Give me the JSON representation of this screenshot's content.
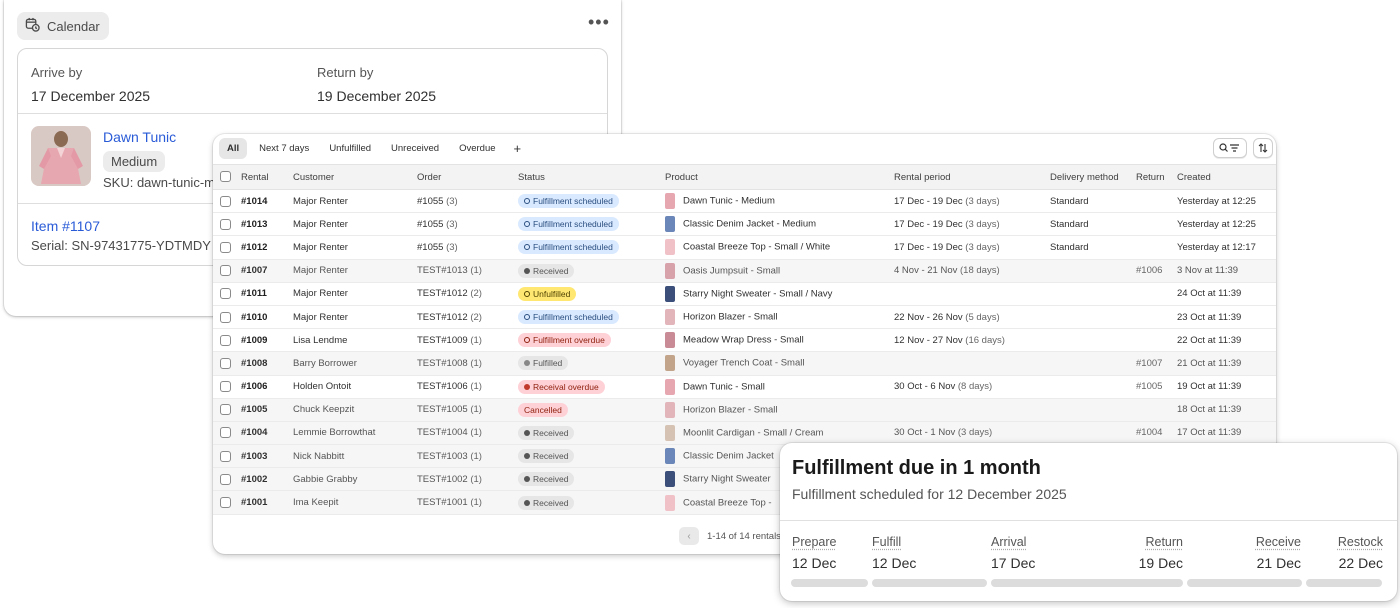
{
  "detail": {
    "calendar_label": "Calendar",
    "more_label": "•••",
    "arrive_label": "Arrive by",
    "arrive_value": "17 December 2025",
    "return_label": "Return by",
    "return_value": "19 December 2025",
    "product_name": "Dawn Tunic",
    "variant": "Medium",
    "sku": "SKU: dawn-tunic-m",
    "item_link": "Item #1107",
    "serial": "Serial: SN-97431775-YDTMDY"
  },
  "table": {
    "tabs": [
      "All",
      "Next 7 days",
      "Unfulfilled",
      "Unreceived",
      "Overdue"
    ],
    "add_tab": "+",
    "columns": [
      "Rental",
      "Customer",
      "Order",
      "Status",
      "Product",
      "Rental period",
      "Delivery method",
      "Return",
      "Created"
    ],
    "rows": [
      {
        "rental": "#1014",
        "customer": "Major Renter",
        "order": "#1055",
        "qty": "(3)",
        "status": "Fulfillment scheduled",
        "kind": "sched",
        "product": "Dawn Tunic - Medium",
        "period": "17 Dec - 19 Dec",
        "days": "(3 days)",
        "delivery": "Standard",
        "ret": "",
        "created": "Yesterday at 12:25",
        "dim": false
      },
      {
        "rental": "#1013",
        "customer": "Major Renter",
        "order": "#1055",
        "qty": "(3)",
        "status": "Fulfillment scheduled",
        "kind": "sched",
        "product": "Classic Denim Jacket - Medium",
        "period": "17 Dec - 19 Dec",
        "days": "(3 days)",
        "delivery": "Standard",
        "ret": "",
        "created": "Yesterday at 12:25",
        "dim": false
      },
      {
        "rental": "#1012",
        "customer": "Major Renter",
        "order": "#1055",
        "qty": "(3)",
        "status": "Fulfillment scheduled",
        "kind": "sched",
        "product": "Coastal Breeze Top - Small / White",
        "period": "17 Dec - 19 Dec",
        "days": "(3 days)",
        "delivery": "Standard",
        "ret": "",
        "created": "Yesterday at 12:17",
        "dim": false
      },
      {
        "rental": "#1007",
        "customer": "Major Renter",
        "order": "TEST#1013",
        "qty": "(1)",
        "status": "Received",
        "kind": "recv",
        "product": "Oasis Jumpsuit - Small",
        "period": "4 Nov - 21 Nov",
        "days": "(18 days)",
        "delivery": "",
        "ret": "#1006",
        "created": "3 Nov at 11:39",
        "dim": true
      },
      {
        "rental": "#1011",
        "customer": "Major Renter",
        "order": "TEST#1012",
        "qty": "(2)",
        "status": "Unfulfilled",
        "kind": "unful",
        "product": "Starry Night Sweater - Small / Navy",
        "period": "",
        "days": "",
        "delivery": "",
        "ret": "",
        "created": "24 Oct at 11:39",
        "dim": false
      },
      {
        "rental": "#1010",
        "customer": "Major Renter",
        "order": "TEST#1012",
        "qty": "(2)",
        "status": "Fulfillment scheduled",
        "kind": "sched",
        "product": "Horizon Blazer - Small",
        "period": "22 Nov - 26 Nov",
        "days": "(5 days)",
        "delivery": "",
        "ret": "",
        "created": "23 Oct at 11:39",
        "dim": false
      },
      {
        "rental": "#1009",
        "customer": "Lisa Lendme",
        "order": "TEST#1009",
        "qty": "(1)",
        "status": "Fulfillment overdue",
        "kind": "overdue",
        "product": "Meadow Wrap Dress - Small",
        "period": "12 Nov - 27 Nov",
        "days": "(16 days)",
        "delivery": "",
        "ret": "",
        "created": "22 Oct at 11:39",
        "dim": false
      },
      {
        "rental": "#1008",
        "customer": "Barry Borrower",
        "order": "TEST#1008",
        "qty": "(1)",
        "status": "Fulfilled",
        "kind": "ful",
        "product": "Voyager Trench Coat - Small",
        "period": "",
        "days": "",
        "delivery": "",
        "ret": "#1007",
        "created": "21 Oct at 11:39",
        "dim": true
      },
      {
        "rental": "#1006",
        "customer": "Holden Ontoit",
        "order": "TEST#1006",
        "qty": "(1)",
        "status": "Receival overdue",
        "kind": "recvover",
        "product": "Dawn Tunic - Small",
        "period": "30 Oct - 6 Nov",
        "days": "(8 days)",
        "delivery": "",
        "ret": "#1005",
        "created": "19 Oct at 11:39",
        "dim": false
      },
      {
        "rental": "#1005",
        "customer": "Chuck Keepzit",
        "order": "TEST#1005",
        "qty": "(1)",
        "status": "Cancelled",
        "kind": "cancel",
        "product": "Horizon Blazer - Small",
        "period": "",
        "days": "",
        "delivery": "",
        "ret": "",
        "created": "18 Oct at 11:39",
        "dim": true
      },
      {
        "rental": "#1004",
        "customer": "Lemmie Borrowthat",
        "order": "TEST#1004",
        "qty": "(1)",
        "status": "Received",
        "kind": "recv",
        "product": "Moonlit Cardigan - Small / Cream",
        "period": "30 Oct - 1 Nov",
        "days": "(3 days)",
        "delivery": "",
        "ret": "#1004",
        "created": "17 Oct at 11:39",
        "dim": true
      },
      {
        "rental": "#1003",
        "customer": "Nick Nabbitt",
        "order": "TEST#1003",
        "qty": "(1)",
        "status": "Received",
        "kind": "recv",
        "product": "Classic Denim Jacket",
        "period": "",
        "days": "",
        "delivery": "",
        "ret": "",
        "created": "",
        "dim": true
      },
      {
        "rental": "#1002",
        "customer": "Gabbie Grabby",
        "order": "TEST#1002",
        "qty": "(1)",
        "status": "Received",
        "kind": "recv",
        "product": "Starry Night Sweater",
        "period": "",
        "days": "",
        "delivery": "",
        "ret": "",
        "created": "",
        "dim": true
      },
      {
        "rental": "#1001",
        "customer": "Ima Keepit",
        "order": "TEST#1001",
        "qty": "(1)",
        "status": "Received",
        "kind": "recv",
        "product": "Coastal Breeze Top -",
        "period": "",
        "days": "",
        "delivery": "",
        "ret": "",
        "created": "",
        "dim": true
      }
    ],
    "pagination": "1-14 of 14 rentals"
  },
  "fulfillment": {
    "title": "Fulfillment due in 1 month",
    "subtitle": "Fulfillment scheduled for 12 December 2025",
    "stages": [
      {
        "label": "Prepare",
        "date": "12 Dec"
      },
      {
        "label": "Fulfill",
        "date": "12 Dec"
      },
      {
        "label": "Arrival",
        "date": "17 Dec"
      },
      {
        "label": "Return",
        "date": "19 Dec"
      },
      {
        "label": "Receive",
        "date": "21 Dec"
      },
      {
        "label": "Restock",
        "date": "22 Dec"
      }
    ]
  },
  "colors": {
    "link": "#2a5bd7",
    "scheduled_badge": "#d9e9ff",
    "unfulfilled_badge": "#ffe772",
    "overdue_badge": "#fed1d7",
    "received_badge": "#e6e6e6"
  }
}
